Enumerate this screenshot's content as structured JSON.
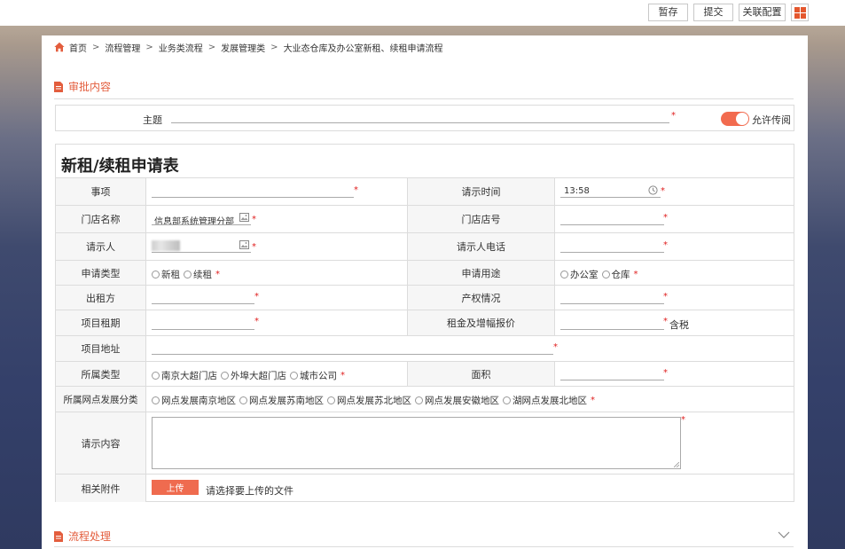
{
  "toolbar": {
    "save_label": "暂存",
    "submit_label": "提交",
    "link_config_label": "关联配置"
  },
  "breadcrumb": {
    "items": [
      "首页",
      "流程管理",
      "业务类流程",
      "发展管理类",
      "大业态仓库及办公室新租、续租申请流程"
    ]
  },
  "sections": {
    "approval_title": "审批内容",
    "process_title": "流程处理"
  },
  "subject": {
    "label": "主题",
    "value": "",
    "required_mark": "*",
    "allow_forward_label": "允许传阅",
    "allow_forward_on": true
  },
  "form": {
    "title": "新租/续租申请表",
    "item_label": "事项",
    "item_value": "",
    "request_time_label": "请示时间",
    "request_time_value": "13:58",
    "store_name_label": "门店名称",
    "store_name_value": "信息部系统管理分部",
    "store_no_label": "门店店号",
    "store_no_value": "",
    "requester_label": "请示人",
    "requester_phone_label": "请示人电话",
    "requester_phone_value": "",
    "apply_type_label": "申请类型",
    "apply_type_options": [
      "新租",
      "续租"
    ],
    "apply_use_label": "申请用途",
    "apply_use_options": [
      "办公室",
      "仓库"
    ],
    "lessor_label": "出租方",
    "lessor_value": "",
    "property_label": "产权情况",
    "property_value": "",
    "term_label": "项目租期",
    "term_value": "",
    "rent_label": "租金及增幅报价",
    "rent_value": "",
    "tax_note": "含税",
    "address_label": "项目地址",
    "address_value": "",
    "belong_type_label": "所属类型",
    "belong_type_options": [
      "南京大超门店",
      "外埠大超门店",
      "城市公司"
    ],
    "area_label": "面积",
    "area_value": "",
    "network_label": "所属网点发展分类",
    "network_options": [
      "网点发展南京地区",
      "网点发展苏南地区",
      "网点发展苏北地区",
      "网点发展安徽地区",
      "湖网点发展北地区"
    ],
    "content_label": "请示内容",
    "content_value": "",
    "attachment_label": "相关附件",
    "upload_label": "上传",
    "upload_hint": "请选择要上传的文件",
    "required_mark": "*"
  },
  "colors": {
    "accent": "#e35d3d",
    "toggle_on": "#f26b4f",
    "upload_button": "#ef6b4f",
    "required": "#e02020"
  },
  "icons": {
    "home": "home-icon",
    "document": "document-icon",
    "clock": "clock-icon",
    "image_picker": "image-picker-icon",
    "chevron": "chevron-down-icon",
    "grid": "grid-icon"
  }
}
